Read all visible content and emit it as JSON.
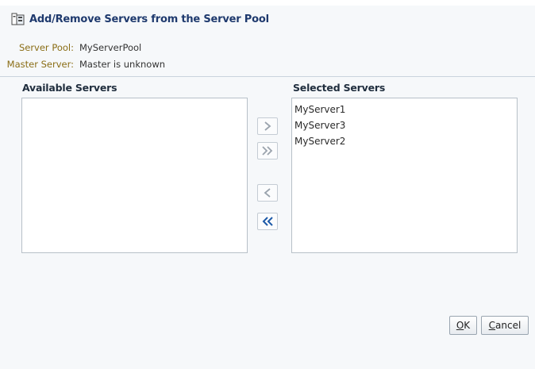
{
  "dialog": {
    "title": "Add/Remove Servers from the Server Pool",
    "title_icon": "server-pool-icon"
  },
  "properties": {
    "server_pool_label": "Server Pool:",
    "server_pool_value": "MyServerPool",
    "master_server_label": "Master Server:",
    "master_server_value": "Master is unknown"
  },
  "available": {
    "title": "Available Servers",
    "items": []
  },
  "selected": {
    "title": "Selected Servers",
    "items": [
      {
        "label": "MyServer1"
      },
      {
        "label": "MyServer3"
      },
      {
        "label": "MyServer2"
      }
    ]
  },
  "shuttle": {
    "move_icon": "chevron-right-icon",
    "move_all_icon": "double-chevron-right-icon",
    "remove_icon": "chevron-left-icon",
    "remove_all_icon": "double-chevron-left-icon",
    "active_color": "#1d5aa8",
    "disabled_color": "#9aa3ad"
  },
  "buttons": {
    "ok_mnemonic": "O",
    "ok_rest": "K",
    "cancel_mnemonic": "C",
    "cancel_rest": "ancel"
  }
}
